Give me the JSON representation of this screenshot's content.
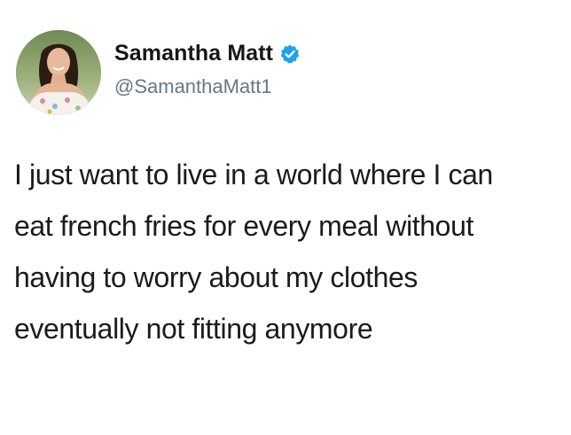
{
  "user": {
    "display_name": "Samantha Matt",
    "handle": "@SamanthaMatt1",
    "verified": true,
    "avatar_icon": "profile-photo",
    "verified_icon": "verified-badge-icon"
  },
  "tweet": {
    "lines": [
      "I just want to live in a world where I can",
      "eat french fries for every meal without",
      "having to worry about my clothes",
      "eventually not fitting anymore"
    ]
  },
  "colors": {
    "verified_blue": "#1da1f2",
    "handle_gray": "#657786",
    "text": "#1b1b1b",
    "background": "#ffffff"
  }
}
